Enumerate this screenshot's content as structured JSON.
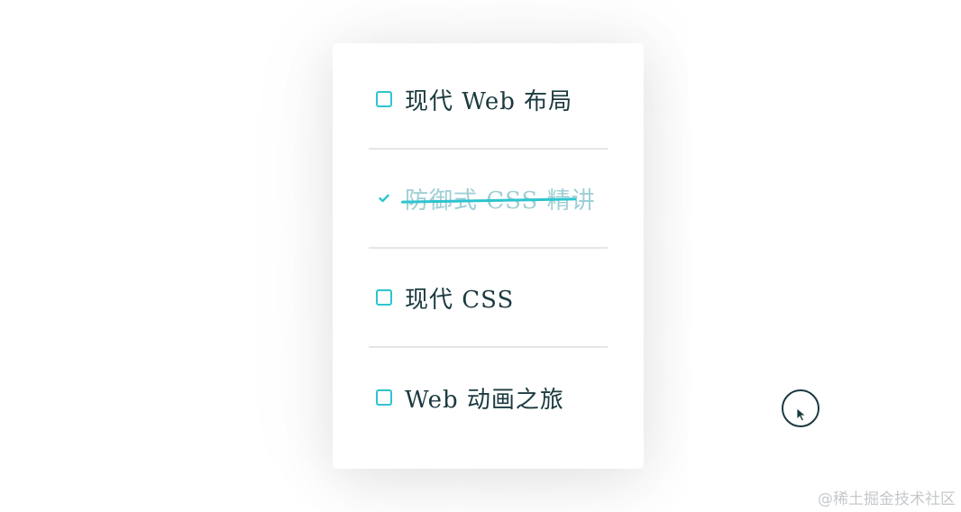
{
  "todo_list": {
    "items": [
      {
        "label": "现代 Web 布局",
        "checked": false
      },
      {
        "label": "防御式 CSS 精讲",
        "checked": true
      },
      {
        "label": "现代 CSS",
        "checked": false
      },
      {
        "label": "Web 动画之旅",
        "checked": false
      }
    ]
  },
  "watermark": "@稀土掘金技术社区",
  "colors": {
    "accent": "#2ec4cf",
    "text": "#1b3a3f",
    "done_text": "#9ecfd5",
    "divider": "#e3e6e6"
  },
  "icons": {
    "unchecked": "checkbox-icon",
    "checked": "checkmark-icon",
    "cursor": "mouse-pointer-icon"
  }
}
